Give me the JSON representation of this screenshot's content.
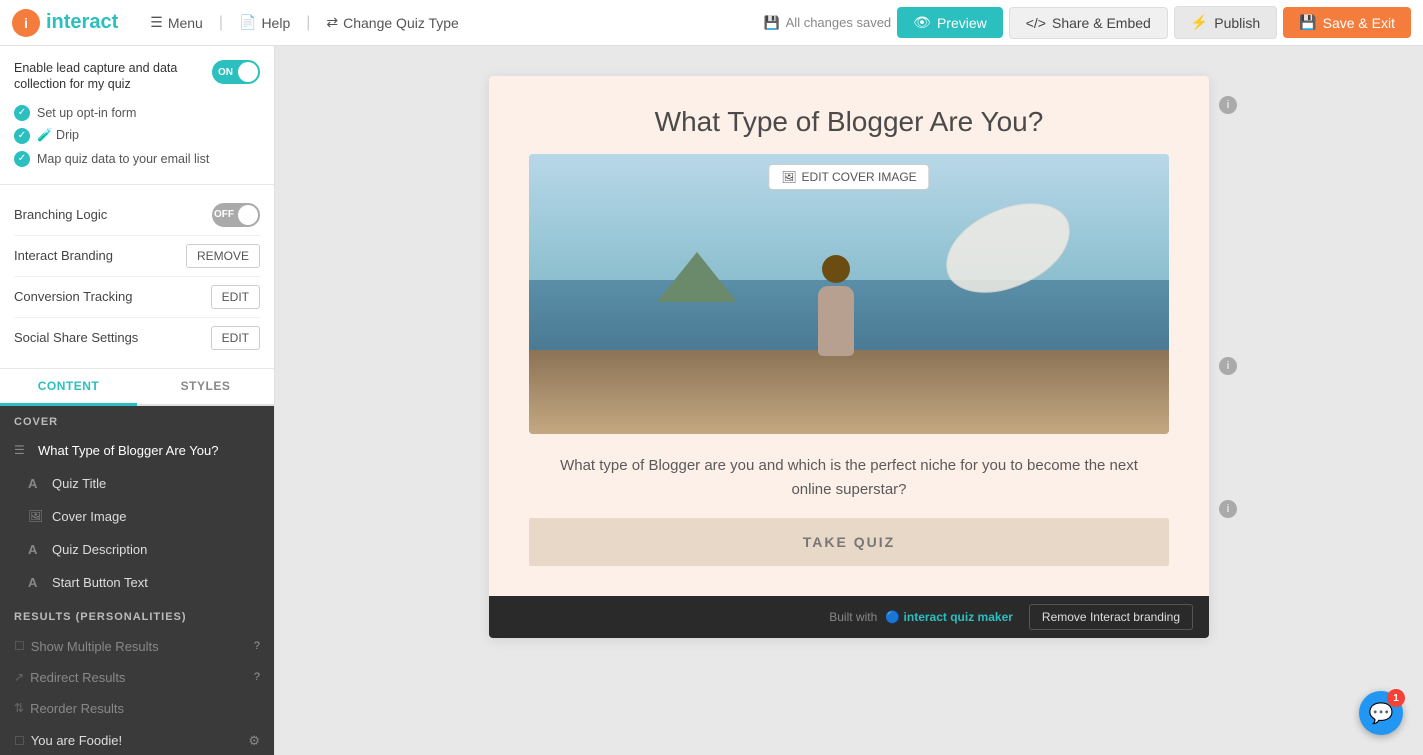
{
  "brand": {
    "icon_text": "i",
    "name": "interact"
  },
  "nav": {
    "menu_label": "Menu",
    "help_label": "Help",
    "change_quiz_type_label": "Change Quiz Type",
    "status_label": "All changes saved",
    "preview_label": "Preview",
    "share_embed_label": "Share & Embed",
    "publish_label": "Publish",
    "save_exit_label": "Save & Exit"
  },
  "sidebar_top": {
    "toggle_label": "Enable lead capture and data collection for my quiz",
    "toggle_state": "ON",
    "checklist": [
      {
        "label": "Set up opt-in form"
      },
      {
        "label": "🧪 Drip"
      },
      {
        "label": "Map quiz data to your email list"
      }
    ],
    "branching_logic_label": "Branching Logic",
    "branching_logic_state": "OFF",
    "interact_branding_label": "Interact Branding",
    "interact_branding_action": "REMOVE",
    "conversion_tracking_label": "Conversion Tracking",
    "conversion_tracking_action": "EDIT",
    "social_share_label": "Social Share Settings",
    "social_share_action": "EDIT"
  },
  "tabs": {
    "content_label": "CONTENT",
    "styles_label": "STYLES"
  },
  "sidebar_content": {
    "cover_label": "COVER",
    "quiz_title": "What Type of Blogger Are You?",
    "items": [
      {
        "icon": "A",
        "label": "Quiz Title",
        "type": "letter"
      },
      {
        "icon": "🖼",
        "label": "Cover Image",
        "type": "image"
      },
      {
        "icon": "A",
        "label": "Quiz Description",
        "type": "letter"
      },
      {
        "icon": "A",
        "label": "Start Button Text",
        "type": "letter"
      }
    ],
    "results_label": "RESULTS (PERSONALITIES)",
    "result_items": [
      {
        "label": "Show Multiple Results"
      },
      {
        "label": "Redirect Results"
      },
      {
        "label": "Reorder Results"
      }
    ],
    "you_item_label": "You are Foodie!"
  },
  "quiz": {
    "title": "What Type of Blogger Are You?",
    "description": "What type of Blogger are you and which is the perfect niche for you to become the next online superstar?",
    "cta_button": "TAKE QUIZ",
    "edit_cover_label": "EDIT COVER IMAGE"
  },
  "branding": {
    "built_with_label": "Built with",
    "logo_label": "🔵 interact quiz maker",
    "remove_label": "Remove Interact branding"
  },
  "chat": {
    "badge": "1"
  }
}
